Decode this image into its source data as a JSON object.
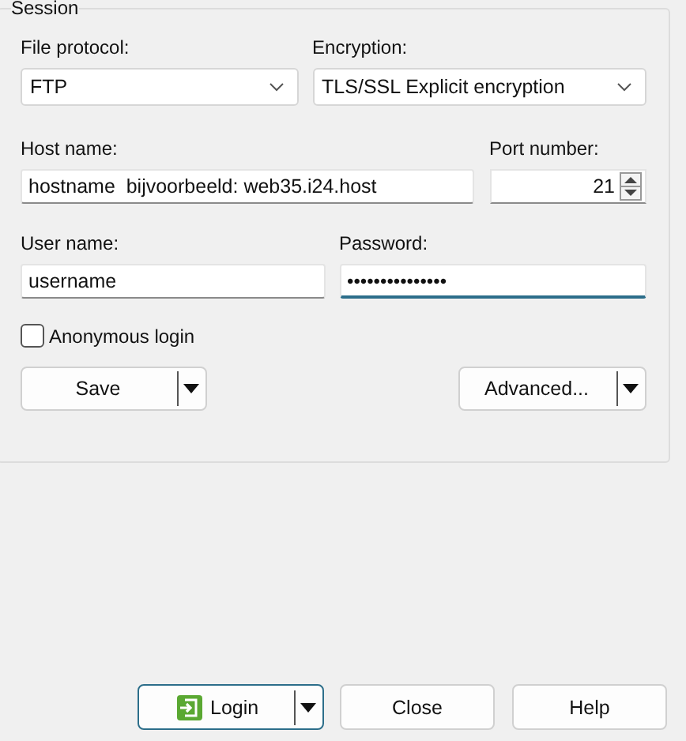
{
  "session": {
    "title": "Session",
    "file_protocol": {
      "label": "File protocol:",
      "value": "FTP"
    },
    "encryption": {
      "label": "Encryption:",
      "value": "TLS/SSL Explicit encryption"
    },
    "host_name": {
      "label": "Host name:",
      "value": "hostname  bijvoorbeeld: web35.i24.host"
    },
    "port_number": {
      "label": "Port number:",
      "value": "21"
    },
    "user_name": {
      "label": "User name:",
      "value": "username"
    },
    "password": {
      "label": "Password:",
      "value": "•••••••••••••••",
      "focused": true
    },
    "anonymous_login": {
      "label": "Anonymous login",
      "checked": false
    },
    "buttons": [
      {
        "label": "Save"
      },
      {
        "label": "Advanced..."
      }
    ]
  },
  "footer_buttons": [
    {
      "label": "Login",
      "kind": "split",
      "default": true
    },
    {
      "label": "Close",
      "kind": "plain",
      "default": false
    },
    {
      "label": "Help",
      "kind": "plain",
      "default": false
    }
  ]
}
